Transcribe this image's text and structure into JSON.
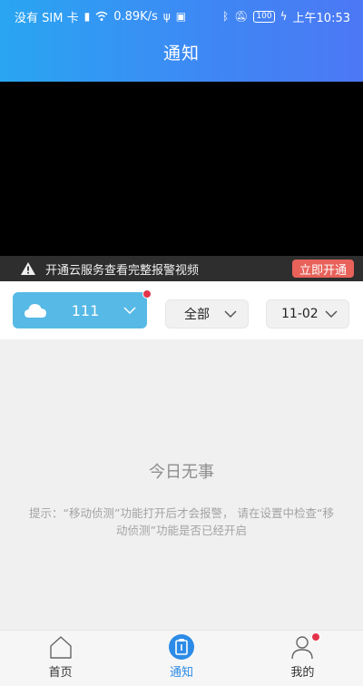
{
  "status_bar": {
    "carrier": "没有 SIM 卡",
    "network_speed": "0.89K/s",
    "battery": "100",
    "time": "上午10:53"
  },
  "header": {
    "title": "通知"
  },
  "banner": {
    "text": "开通云服务查看完整报警视频",
    "button_label": "立即开通"
  },
  "filters": {
    "device": {
      "name": "111",
      "has_alert_dot": true
    },
    "type_filter": {
      "value": "全部"
    },
    "date_filter": {
      "value": "11-02"
    }
  },
  "content": {
    "empty_title": "今日无事",
    "hint": "提示：“移动侦测”功能打开后才会报警， 请在设置中检查“移动侦测”功能是否已经开启"
  },
  "bottom_nav": {
    "items": [
      {
        "label": "首页",
        "icon": "home-icon",
        "active": false
      },
      {
        "label": "通知",
        "icon": "notification-icon",
        "active": true,
        "has_badge": true
      },
      {
        "label": "我的",
        "icon": "profile-icon",
        "active": false
      }
    ]
  },
  "colors": {
    "header_gradient_start": "#29a6f2",
    "header_gradient_end": "#4c78f5",
    "device_select_bg": "#56b9e6",
    "alert_red": "#e3344a",
    "open_button": "#e8625a",
    "active_nav": "#2c8be6"
  }
}
